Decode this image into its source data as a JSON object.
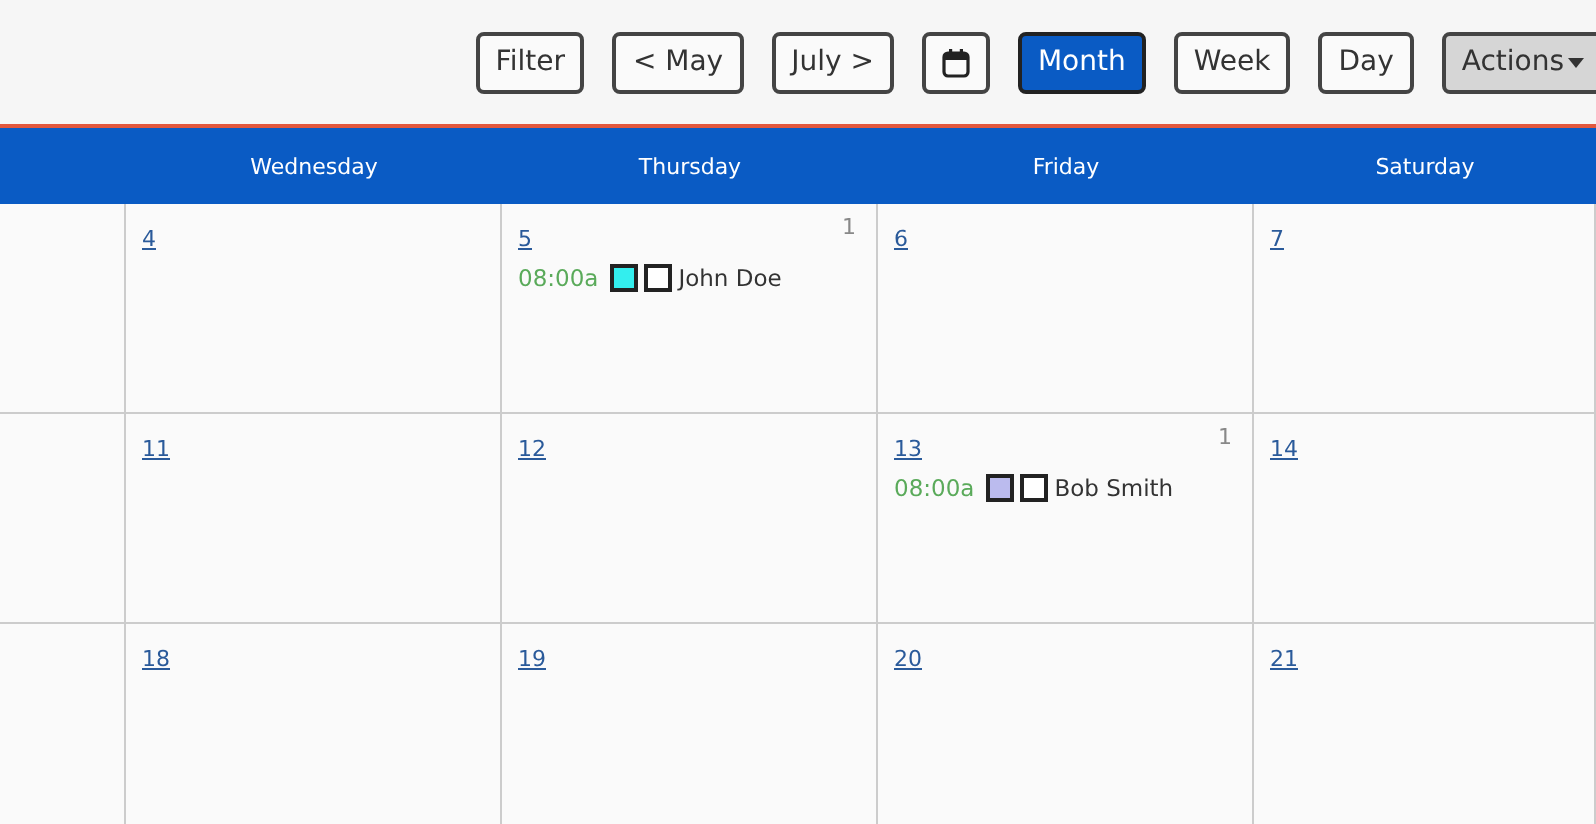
{
  "toolbar": [
    {
      "kind": "text",
      "label": "Filter",
      "selected": false
    },
    {
      "kind": "text",
      "label": "< May",
      "selected": false
    },
    {
      "kind": "text",
      "label": "July >",
      "selected": false
    },
    {
      "kind": "calendar",
      "selected": false
    },
    {
      "kind": "text",
      "label": "Month",
      "selected": true
    },
    {
      "kind": "text",
      "label": "Week",
      "selected": false
    },
    {
      "kind": "text",
      "label": "Day",
      "selected": false
    },
    {
      "kind": "menu",
      "label": "Actions",
      "selected": false
    }
  ],
  "weekdays": [
    "Wednesday",
    "Thursday",
    "Friday",
    "Saturday"
  ],
  "weeks": [
    {
      "days": [
        {
          "date": "4"
        },
        {
          "date": "5",
          "count": "1",
          "events": [
            {
              "time": "08:00a",
              "color": "#33eeee",
              "checked": false,
              "name": "John Doe"
            }
          ]
        },
        {
          "date": "6"
        },
        {
          "date": "7"
        }
      ]
    },
    {
      "days": [
        {
          "date": "11"
        },
        {
          "date": "12"
        },
        {
          "date": "13",
          "count": "1",
          "events": [
            {
              "time": "08:00a",
              "color": "#bbbbee",
              "checked": false,
              "name": "Bob Smith"
            }
          ]
        },
        {
          "date": "14"
        }
      ]
    },
    {
      "days": [
        {
          "date": "18"
        },
        {
          "date": "19"
        },
        {
          "date": "20"
        },
        {
          "date": "21"
        }
      ]
    }
  ]
}
